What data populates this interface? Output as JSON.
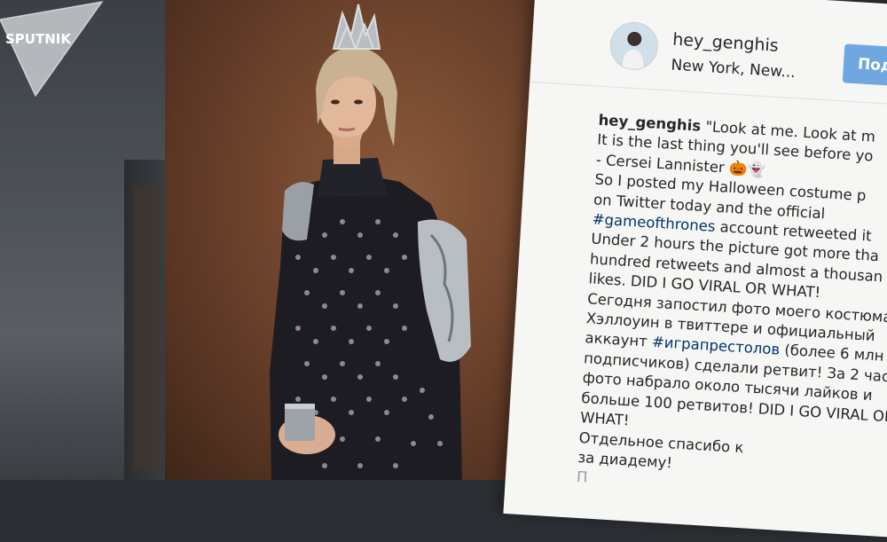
{
  "watermark": {
    "brand": "SPUTNIK"
  },
  "post": {
    "username": "hey_genghis",
    "location": "New York, New...",
    "follow_label": "Под",
    "caption": {
      "username": "hey_genghis",
      "lines": [
        "\"Look at me. Look at m",
        "It is the last thing you'll see before yo",
        "- Cersei Lannister 🎃👻",
        "So I posted my Halloween costume p",
        "on Twitter today and the official",
        "#gameofthrones",
        " account retweeted it",
        "Under 2 hours the picture got more tha",
        "hundred retweets and almost a thousan",
        "likes. DID I GO VIRAL OR WHAT!",
        "Сегодня запостил фото моего костюма",
        "Хэллоуин в твиттере и официальный",
        "аккаунт ",
        "#игрaпрестолов",
        " (более 6 млн",
        "подписчиков) сделали ретвит! За 2 часа",
        "фото набрало около тысячи лайков и",
        "больше 100 ретвитов! DID I GO VIRAL OR",
        "WHAT!",
        "Отдельное спасибо к",
        "за диадему!",
        "П"
      ]
    }
  },
  "colors": {
    "follow_button": "#70a7e0",
    "hashtag": "#003569",
    "panel_bg": "#f6f6f4"
  },
  "icons": [
    "sputnik-logo-icon"
  ]
}
